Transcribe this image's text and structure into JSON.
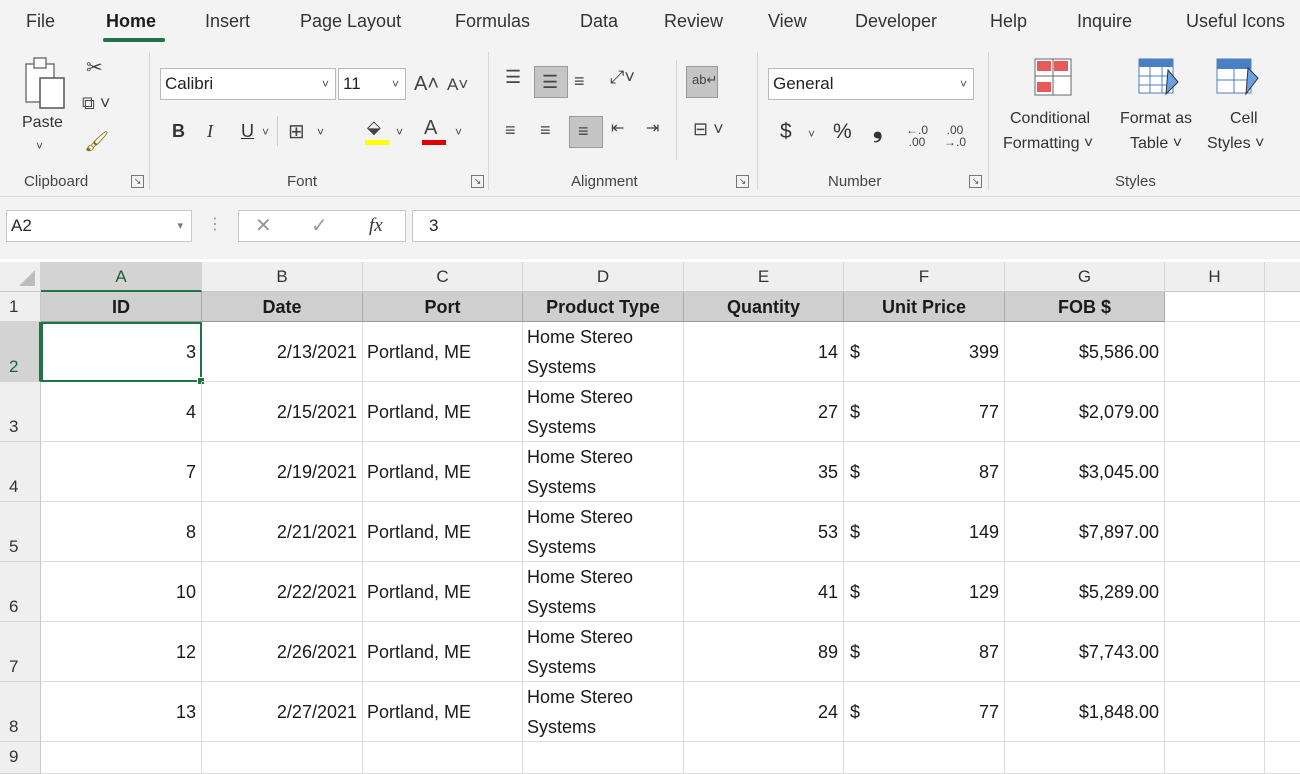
{
  "tabs": [
    "File",
    "Home",
    "Insert",
    "Page Layout",
    "Formulas",
    "Data",
    "Review",
    "View",
    "Developer",
    "Help",
    "Inquire",
    "Useful Icons"
  ],
  "ribbon": {
    "clipboard": {
      "paste_label": "Paste",
      "group_label": "Clipboard"
    },
    "font": {
      "font_name": "Calibri",
      "font_size": "11",
      "bold": "B",
      "italic": "I",
      "underline": "U",
      "group_label": "Font"
    },
    "alignment": {
      "group_label": "Alignment"
    },
    "number": {
      "format": "General",
      "currency": "$",
      "percent": "%",
      "comma": "❟",
      "group_label": "Number"
    },
    "styles": {
      "conditional_line1": "Conditional",
      "conditional_line2": "Formatting ˅",
      "format_table_line1": "Format as",
      "format_table_line2": "Table ˅",
      "cell_styles_line1": "Cell",
      "cell_styles_line2": "Styles ˅",
      "group_label": "Styles"
    }
  },
  "formula_bar": {
    "name_box": "A2",
    "fx": "fx",
    "content": "3"
  },
  "columns": [
    "A",
    "B",
    "C",
    "D",
    "E",
    "F",
    "G",
    "H"
  ],
  "row_numbers": [
    "1",
    "2",
    "3",
    "4",
    "5",
    "6",
    "7",
    "8",
    "9"
  ],
  "headers": [
    "ID",
    "Date",
    "Port",
    "Product Type",
    "Quantity",
    "Unit Price",
    "FOB $"
  ],
  "rows": [
    {
      "id": "3",
      "date": "2/13/2021",
      "port": "Portland, ME",
      "type1": "Home Stereo",
      "type2": "Systems",
      "qty": "14",
      "cur": "$",
      "price": "399",
      "fob": "$5,586.00"
    },
    {
      "id": "4",
      "date": "2/15/2021",
      "port": "Portland, ME",
      "type1": "Home Stereo",
      "type2": "Systems",
      "qty": "27",
      "cur": "$",
      "price": "77",
      "fob": "$2,079.00"
    },
    {
      "id": "7",
      "date": "2/19/2021",
      "port": "Portland, ME",
      "type1": "Home Stereo",
      "type2": "Systems",
      "qty": "35",
      "cur": "$",
      "price": "87",
      "fob": "$3,045.00"
    },
    {
      "id": "8",
      "date": "2/21/2021",
      "port": "Portland, ME",
      "type1": "Home Stereo",
      "type2": "Systems",
      "qty": "53",
      "cur": "$",
      "price": "149",
      "fob": "$7,897.00"
    },
    {
      "id": "10",
      "date": "2/22/2021",
      "port": "Portland, ME",
      "type1": "Home Stereo",
      "type2": "Systems",
      "qty": "41",
      "cur": "$",
      "price": "129",
      "fob": "$5,289.00"
    },
    {
      "id": "12",
      "date": "2/26/2021",
      "port": "Portland, ME",
      "type1": "Home Stereo",
      "type2": "Systems",
      "qty": "89",
      "cur": "$",
      "price": "87",
      "fob": "$7,743.00"
    },
    {
      "id": "13",
      "date": "2/27/2021",
      "port": "Portland, ME",
      "type1": "Home Stereo",
      "type2": "Systems",
      "qty": "24",
      "cur": "$",
      "price": "77",
      "fob": "$1,848.00"
    }
  ],
  "colors": {
    "accent": "#217346",
    "header_fill": "#cfcfcf",
    "ribbon_bg": "#f3f3f3"
  }
}
